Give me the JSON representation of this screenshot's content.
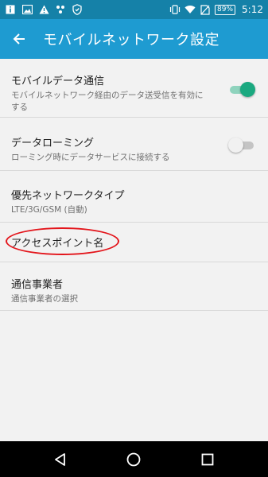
{
  "status_bar": {
    "icons": [
      "info-icon",
      "image-icon",
      "warning-icon",
      "dots-icon",
      "shield-icon",
      "vibrate-icon",
      "wifi-icon",
      "no-sim-icon"
    ],
    "battery": "89%",
    "time": "5:12",
    "color": "#1581a8"
  },
  "app_bar": {
    "title": "モバイルネットワーク設定",
    "back_icon": "arrow-back-icon",
    "color": "#1e9bd1"
  },
  "settings": {
    "mobile_data": {
      "title": "モバイルデータ通信",
      "subtitle": "モバイルネットワーク経由のデータ送受信を有効にする",
      "enabled": true
    },
    "roaming": {
      "title": "データローミング",
      "subtitle": "ローミング時にデータサービスに接続する",
      "enabled": false
    },
    "network_type": {
      "title": "優先ネットワークタイプ",
      "subtitle": "LTE/3G/GSM (自動)"
    },
    "apn": {
      "title": "アクセスポイント名"
    },
    "carrier": {
      "title": "通信事業者",
      "subtitle": "通信事業者の選択"
    }
  },
  "annotation_color": "#e3151b",
  "toggle_on_color": "#1ba980",
  "nav_bar": {
    "buttons": [
      "back-triangle-icon",
      "home-circle-icon",
      "recents-square-icon"
    ]
  }
}
